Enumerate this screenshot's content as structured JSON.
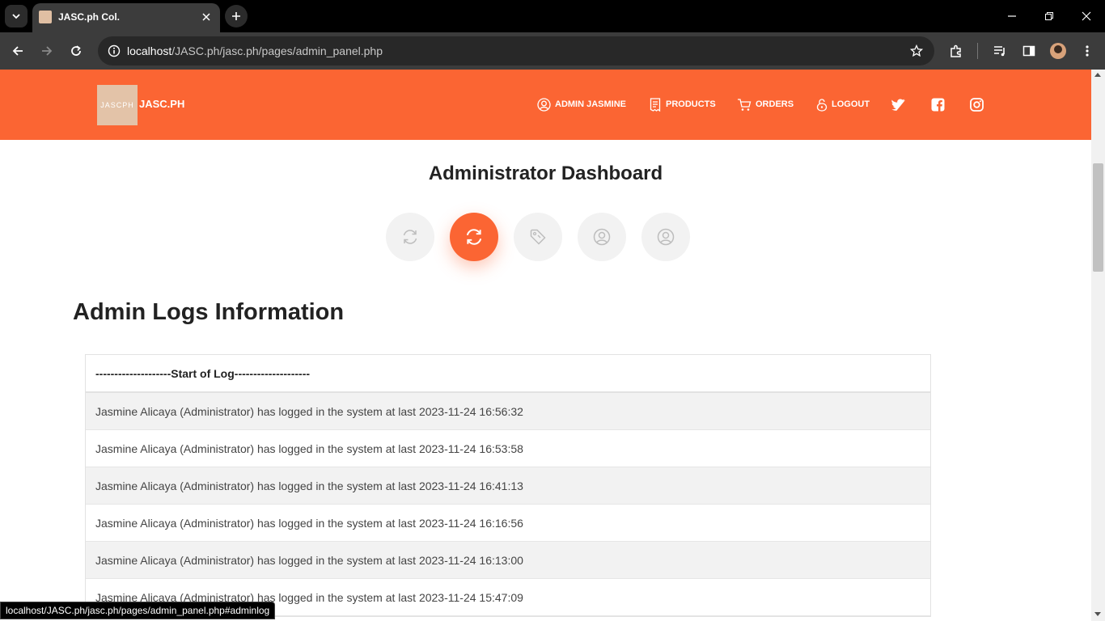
{
  "browser": {
    "tab_title": "JASC.ph Col.",
    "url_host": "localhost",
    "url_path": "/JASC.ph/jasc.ph/pages/admin_panel.php",
    "status_url": "localhost/JASC.ph/jasc.ph/pages/admin_panel.php#adminlog"
  },
  "site": {
    "logo_text": "JASCPH",
    "brand": "JASC.PH",
    "accent_color": "#fb6533",
    "nav": [
      {
        "label": "ADMIN JASMINE",
        "icon": "user-circle-icon"
      },
      {
        "label": "PRODUCTS",
        "icon": "receipt-icon"
      },
      {
        "label": "ORDERS",
        "icon": "cart-icon"
      },
      {
        "label": "LOGOUT",
        "icon": "lock-icon"
      }
    ],
    "social": [
      "twitter-icon",
      "facebook-icon",
      "instagram-icon"
    ]
  },
  "dashboard": {
    "title": "Administrator Dashboard",
    "buttons": [
      {
        "icon": "refresh-icon",
        "active": false
      },
      {
        "icon": "refresh-icon",
        "active": true
      },
      {
        "icon": "tag-icon",
        "active": false
      },
      {
        "icon": "user-circle-icon",
        "active": false
      },
      {
        "icon": "user-circle-icon",
        "active": false
      }
    ]
  },
  "logs": {
    "section_title": "Admin Logs Information",
    "header": "--------------------Start of Log--------------------",
    "entries": [
      "Jasmine Alicaya (Administrator) has logged in the system at last 2023-11-24 16:56:32",
      "Jasmine Alicaya (Administrator) has logged in the system at last 2023-11-24 16:53:58",
      "Jasmine Alicaya (Administrator) has logged in the system at last 2023-11-24 16:41:13",
      "Jasmine Alicaya (Administrator) has logged in the system at last 2023-11-24 16:16:56",
      "Jasmine Alicaya (Administrator) has logged in the system at last 2023-11-24 16:13:00",
      "Jasmine Alicaya (Administrator) has logged in the system at last 2023-11-24 15:47:09"
    ]
  }
}
